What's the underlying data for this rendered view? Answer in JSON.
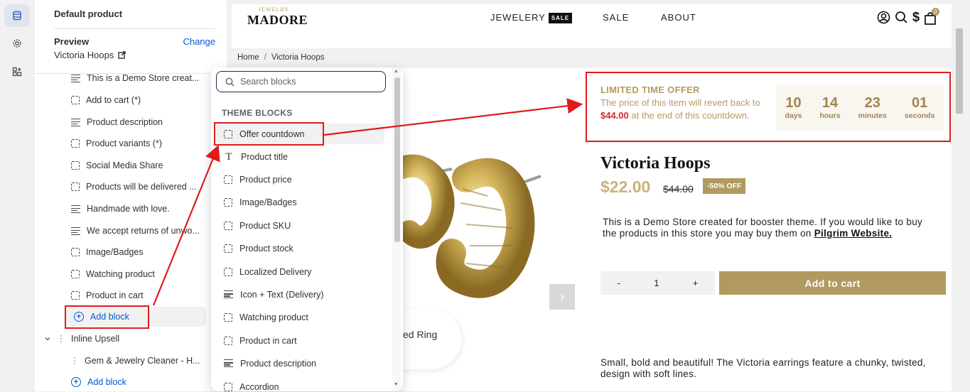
{
  "rail": {
    "icons": [
      "sections-icon",
      "settings-gear-icon",
      "apps-icon"
    ]
  },
  "sidebar": {
    "title": "Default product",
    "preview_label": "Preview",
    "change_label": "Change",
    "preview_product": "Victoria Hoops",
    "items": [
      {
        "label": "This is a Demo Store creat...",
        "icon": "text-lines-icon"
      },
      {
        "label": "Add to cart (*)",
        "icon": "block-icon"
      },
      {
        "label": "Product description",
        "icon": "text-lines-icon"
      },
      {
        "label": "Product variants (*)",
        "icon": "block-icon"
      },
      {
        "label": "Social Media Share",
        "icon": "block-icon"
      },
      {
        "label": "Products will be delivered ...",
        "icon": "block-icon"
      },
      {
        "label": "Handmade with love.",
        "icon": "text-lines-icon"
      },
      {
        "label": "We accept returns of unwo...",
        "icon": "text-lines-icon"
      },
      {
        "label": "Image/Badges",
        "icon": "block-icon"
      },
      {
        "label": "Watching product",
        "icon": "block-icon"
      },
      {
        "label": "Product in cart",
        "icon": "block-icon"
      }
    ],
    "add_block_label": "Add block",
    "section_label": "Inline Upsell",
    "upsell_item": "Gem & Jewelry Cleaner - H...",
    "add_block_label_2": "Add block"
  },
  "picker": {
    "search_placeholder": "Search blocks",
    "section_title": "THEME BLOCKS",
    "items": [
      {
        "label": "Offer countdown",
        "icon": "block-icon"
      },
      {
        "label": "Product title",
        "icon": "text-T-icon"
      },
      {
        "label": "Product price",
        "icon": "block-icon"
      },
      {
        "label": "Image/Badges",
        "icon": "block-icon"
      },
      {
        "label": "Product SKU",
        "icon": "block-icon"
      },
      {
        "label": "Product stock",
        "icon": "block-icon"
      },
      {
        "label": "Localized Delivery",
        "icon": "block-icon"
      },
      {
        "label": "Icon + Text (Delivery)",
        "icon": "text-lines-icon"
      },
      {
        "label": "Watching product",
        "icon": "block-icon"
      },
      {
        "label": "Product in cart",
        "icon": "block-icon"
      },
      {
        "label": "Product description",
        "icon": "text-lines-icon"
      },
      {
        "label": "Accordion",
        "icon": "block-icon"
      }
    ]
  },
  "store": {
    "logo_small": "JEWELRY",
    "logo_big": "MADORE",
    "nav": [
      "JEWELERY",
      "SALE",
      "ABOUT"
    ],
    "nav_badge": "SALE",
    "cart_count": "0",
    "breadcrumb": [
      "Home",
      "Victoria Hoops"
    ],
    "gallery_next": "›",
    "thumb_text": "ed Ring",
    "countdown": {
      "title": "LIMITED TIME OFFER",
      "msg_before": "The price of this item will revert back to ",
      "msg_price": "$44.00",
      "msg_after": " at the end of this countdown.",
      "units": [
        {
          "n": "10",
          "u": "days"
        },
        {
          "n": "14",
          "u": "hours"
        },
        {
          "n": "23",
          "u": "minutes"
        },
        {
          "n": "01",
          "u": "seconds"
        }
      ]
    },
    "product_title": "Victoria Hoops",
    "price": "$22.00",
    "compare_price": "$44.00",
    "discount_badge": "-50% OFF",
    "desc_text": "This is a Demo Store created for booster theme. If you would like to buy the products in this store you may buy them on ",
    "desc_link": "Pilgrim Website.",
    "qty_minus": "-",
    "qty_value": "1",
    "qty_plus": "+",
    "add_to_cart": "Add to cart",
    "long_desc": "Small, bold and beautiful! The Victoria earrings feature a chunky, twisted, design with soft lines."
  },
  "colors": {
    "accent_gold": "#b09a5f",
    "annotation_red": "#e01b1b",
    "link_blue": "#005bd3"
  }
}
